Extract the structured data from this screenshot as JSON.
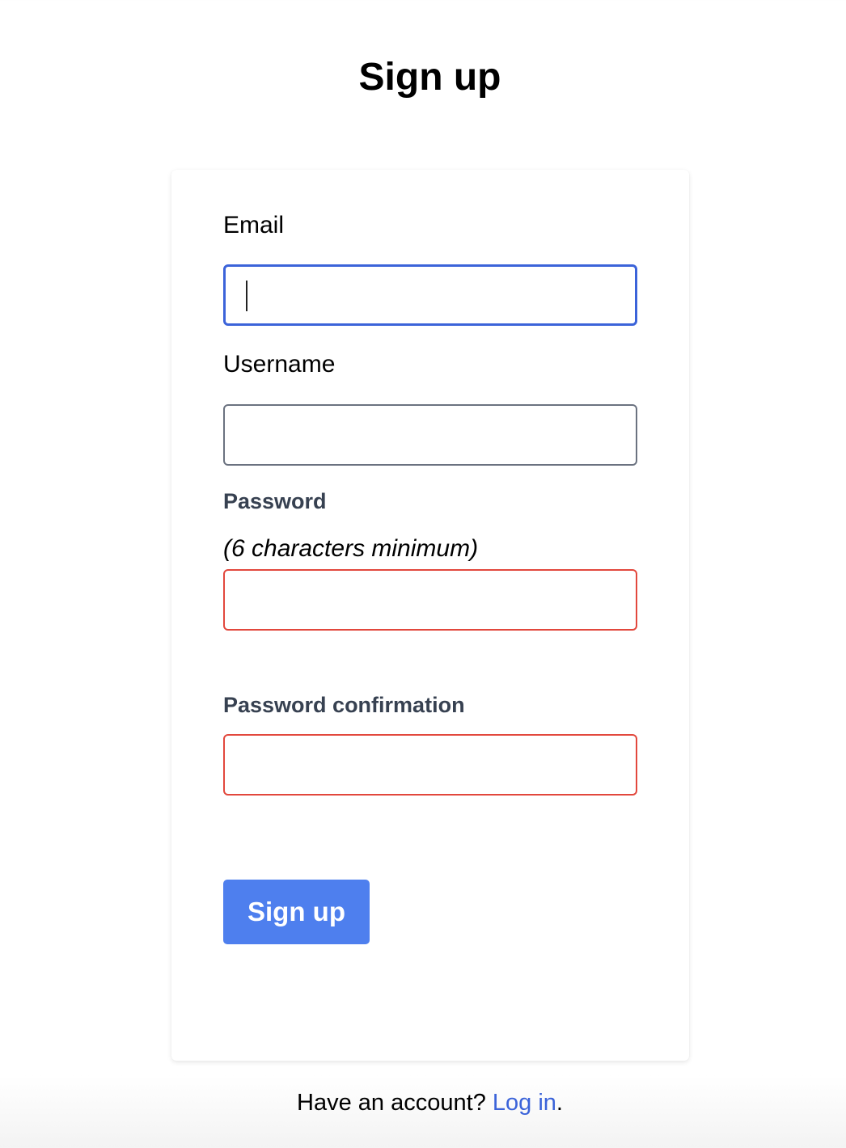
{
  "page": {
    "title": "Sign up"
  },
  "form": {
    "email": {
      "label": "Email",
      "value": "",
      "placeholder": ""
    },
    "username": {
      "label": "Username",
      "value": "",
      "placeholder": ""
    },
    "password": {
      "label": "Password",
      "hint": "(6 characters minimum)",
      "value": "",
      "placeholder": ""
    },
    "password_confirmation": {
      "label": "Password confirmation",
      "value": "",
      "placeholder": ""
    },
    "submit_label": "Sign up"
  },
  "footer": {
    "prompt": "Have an account? ",
    "link_label": "Log in",
    "suffix": "."
  },
  "colors": {
    "accent": "#4e7fee",
    "focus_border": "#3b63d9",
    "error_border": "#e2483d",
    "link": "#3b63d9"
  }
}
